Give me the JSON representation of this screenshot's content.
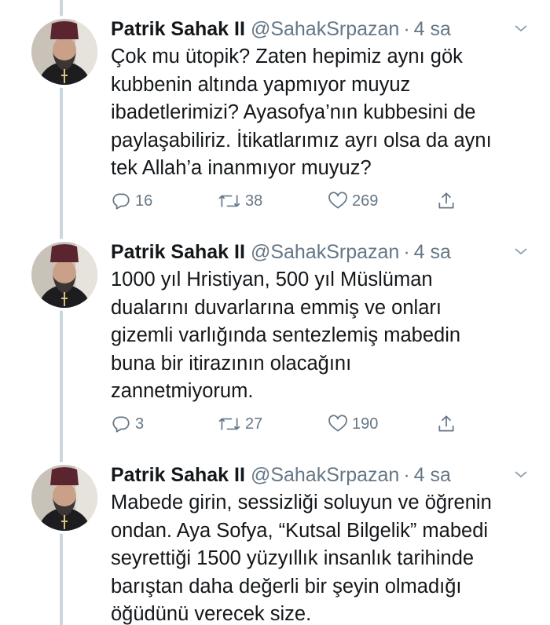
{
  "tweets": [
    {
      "name": "Patrik Sahak II",
      "handle": "@SahakSrpazan",
      "time": "4 sa",
      "text": "Çok mu ütopik? Zaten hepimiz aynı gök\nkubbenin altında yapmıyor muyuz\nibadetlerimizi? Ayasofya’nın kubbesini de\npaylaşabiliriz. İtikatlarımız ayrı olsa da aynı\ntek Allah’a inanmıyor muyuz?",
      "replies": "16",
      "retweets": "38",
      "likes": "269"
    },
    {
      "name": "Patrik Sahak II",
      "handle": "@SahakSrpazan",
      "time": "4 sa",
      "text": "1000 yıl Hristiyan, 500 yıl Müslüman\ndualarını duvarlarına emmiş ve onları\ngizemli varlığında sentezlemiş mabedin\nbuna bir itirazının olacağını\nzannetmiyorum.",
      "replies": "3",
      "retweets": "27",
      "likes": "190"
    },
    {
      "name": "Patrik Sahak II",
      "handle": "@SahakSrpazan",
      "time": "4 sa",
      "text": "Mabede girin, sessizliği soluyun ve öğrenin\nondan. Aya Sofya, “Kutsal Bilgelik” mabedi\nseyrettiği 1500 yüzyıllık insanlık tarihinde\nbarıştan daha değerli bir şeyin olmadığı\nöğüdünü verecek size."
    }
  ],
  "separator": "·",
  "colors": {
    "text": "#14171a",
    "secondary": "#657786",
    "thread_line": "#ccd6dd"
  },
  "icons": [
    "reply-icon",
    "retweet-icon",
    "like-icon",
    "share-icon",
    "chevron-down-icon"
  ]
}
